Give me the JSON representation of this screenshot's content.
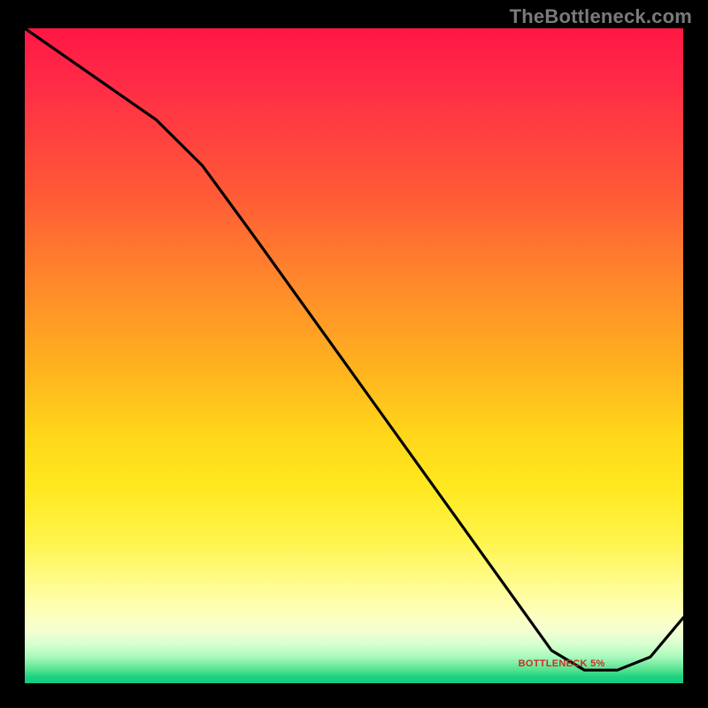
{
  "watermark": "TheBottleneck.com",
  "marker_label": "BOTTLENECK 5%",
  "colors": {
    "marker_text": "#c43127",
    "watermark": "#7a7a7a",
    "curve": "#000000",
    "frame_bg": "#000000"
  },
  "chart_data": {
    "type": "line",
    "title": "",
    "xlabel": "",
    "ylabel": "",
    "xlim": [
      0,
      100
    ],
    "ylim": [
      0,
      100
    ],
    "grid": false,
    "legend": false,
    "annotations": [
      {
        "text": "BOTTLENECK 5%",
        "x": 81,
        "y": 3
      }
    ],
    "series": [
      {
        "name": "bottleneck-curve",
        "x": [
          0,
          10,
          20,
          27,
          35,
          45,
          55,
          65,
          75,
          80,
          85,
          90,
          95,
          100
        ],
        "values": [
          100,
          93,
          86,
          79,
          68,
          54,
          40,
          26,
          12,
          5,
          2,
          2,
          4,
          10
        ]
      }
    ]
  }
}
